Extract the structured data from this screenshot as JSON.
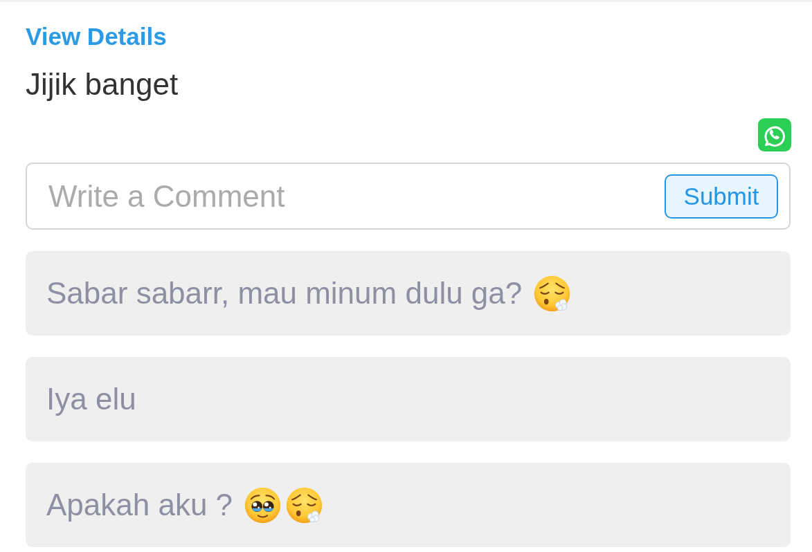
{
  "post": {
    "view_details_link": "View Details",
    "text": "Jijik banget"
  },
  "comment_form": {
    "placeholder": "Write a Comment",
    "submit_label": "Submit"
  },
  "comments": [
    {
      "text": "Sabar sabarr, mau minum dulu ga?",
      "emojis": [
        {
          "kind": "exhaling"
        }
      ]
    },
    {
      "text": "Iya elu"
    },
    {
      "text": "Apakah aku ?",
      "emojis": [
        {
          "kind": "pleading"
        },
        {
          "kind": "exhaling"
        }
      ]
    }
  ]
}
